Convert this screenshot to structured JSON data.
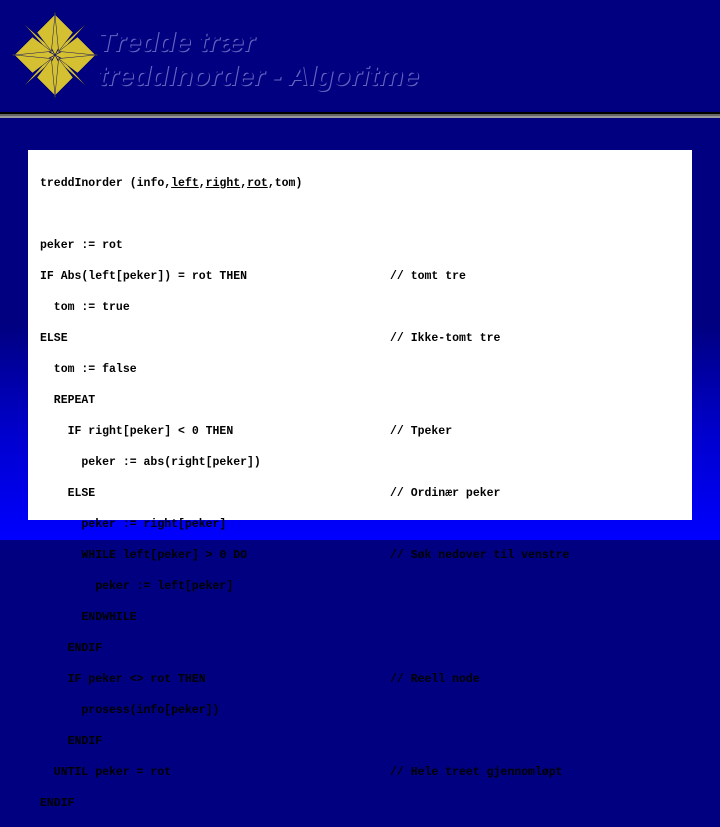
{
  "title_line1": "Tredde trær",
  "title_line2": "treddInorder   -   Algoritme",
  "sig": {
    "name": "treddInorder",
    "open": " (",
    "p1": "info",
    "sep": ",",
    "p2": "left",
    "p3": "right",
    "p4": "rot",
    "p5": "tom",
    "close": ")"
  },
  "code": {
    "l1": "peker := rot",
    "l2": "IF Abs(left[peker]) = rot THEN",
    "c2": "// tomt tre",
    "l3": "  tom := true",
    "l4": "ELSE",
    "c4": "// Ikke-tomt tre",
    "l5": "  tom := false",
    "l6": "  REPEAT",
    "l7": "    IF right[peker] < 0 THEN",
    "c7": "// Tpeker",
    "l8": "      peker := abs(right[peker])",
    "l9": "    ELSE",
    "c9": "// Ordinær peker",
    "l10": "      peker := right[peker]",
    "l11": "      WHILE left[peker] > 0 DO",
    "c11": "// Søk nedover til venstre",
    "l12": "        peker := left[peker]",
    "l13": "      ENDWHILE",
    "l14": "    ENDIF",
    "l15": "    IF peker <> rot THEN",
    "c15": "// Reell node",
    "l16": "      prosess(info[peker])",
    "l17": "    ENDIF",
    "l18": "  UNTIL peker = rot",
    "c18": "// Hele treet gjennomløpt",
    "l19": "ENDIF"
  }
}
